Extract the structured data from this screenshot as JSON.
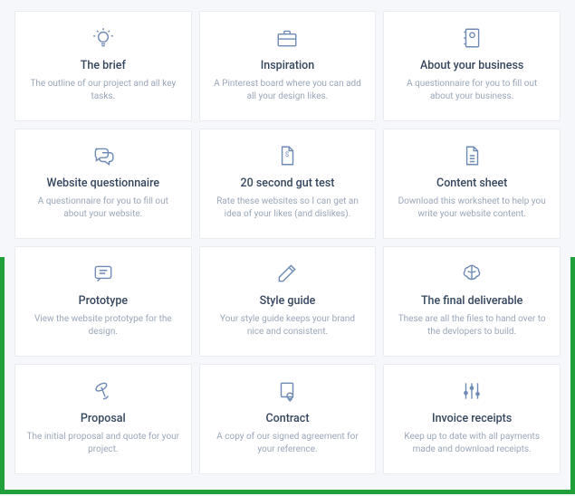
{
  "cards": [
    {
      "title": "The brief",
      "desc": "The outline of our project and all key tasks."
    },
    {
      "title": "Inspiration",
      "desc": "A Pinterest board where you can add all your design likes."
    },
    {
      "title": "About your business",
      "desc": "A questionnaire for you to fill out about your business."
    },
    {
      "title": "Website questionnaire",
      "desc": "A questionnaire for you to fill out about your website."
    },
    {
      "title": "20 second gut test",
      "desc": "Rate these websites so I can get an idea of your likes (and dislikes)."
    },
    {
      "title": "Content sheet",
      "desc": "Download this worksheet to help you write your website content."
    },
    {
      "title": "Prototype",
      "desc": "View the website prototype for the design."
    },
    {
      "title": "Style guide",
      "desc": "Your style guide keeps your brand nice and consistent."
    },
    {
      "title": "The final deliverable",
      "desc": "These are all the files to hand over to the devlopers to build."
    },
    {
      "title": "Proposal",
      "desc": "The initial proposal and quote for your project."
    },
    {
      "title": "Contract",
      "desc": "A copy of our signed agreement for your reference."
    },
    {
      "title": "Invoice receipts",
      "desc": "Keep up to date with all payments made and download receipts."
    }
  ]
}
